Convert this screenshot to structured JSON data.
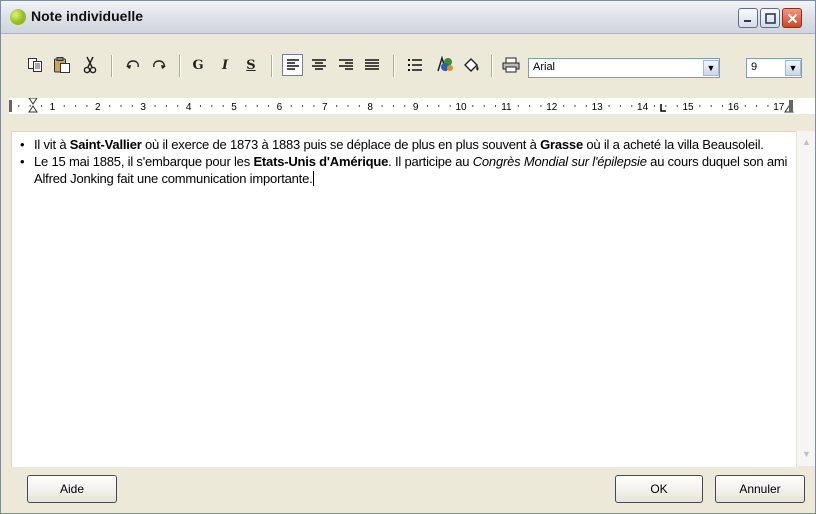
{
  "window": {
    "title": "Note individuelle",
    "controls": {
      "minimize": "–",
      "maximize": "□",
      "close": "✕"
    }
  },
  "toolbar": {
    "copy_icon": "copy-icon",
    "paste_icon": "paste-icon",
    "cut_icon": "cut-icon",
    "undo_icon": "undo-icon",
    "redo_icon": "redo-icon",
    "bold_label": "G",
    "italic_label": "I",
    "strike_label": "S",
    "font": {
      "value": "Arial"
    },
    "size": {
      "value": "9"
    },
    "dropdown_arrow": "▼"
  },
  "ruler": {
    "labels": [
      "1",
      "2",
      "3",
      "4",
      "5",
      "6",
      "7",
      "8",
      "9",
      "10",
      "11",
      "12",
      "13",
      "14",
      "15",
      "16",
      "17"
    ]
  },
  "content": {
    "bullets": [
      {
        "parts": [
          {
            "text": "Il vit  à ",
            "style": "normal"
          },
          {
            "text": "Saint-Vallier",
            "style": "bold"
          },
          {
            "text": " où il exerce  de 1873 à 1883 puis se déplace de plus en plus souvent à ",
            "style": "normal"
          },
          {
            "text": "Grasse",
            "style": "bold"
          },
          {
            "text": " où il a acheté la villa Beausoleil.",
            "style": "normal"
          }
        ]
      },
      {
        "parts": [
          {
            "text": "Le 15 mai 1885, il  s'embarque pour les  ",
            "style": "normal"
          },
          {
            "text": "Etats-Unis d'Amérique",
            "style": "bold"
          },
          {
            "text": ". Il participe au ",
            "style": "normal"
          },
          {
            "text": "Congrès Mondial sur l'épilepsie",
            "style": "italic"
          },
          {
            "text": " au cours duquel son ami Alfred Jonking fait une communication importante.",
            "style": "normal"
          }
        ]
      }
    ]
  },
  "buttons": {
    "help": "Aide",
    "ok": "OK",
    "cancel": "Annuler"
  },
  "colors": {
    "window_bg": "#ece9d8",
    "border": "#7b8ca8",
    "close_button": "#d2452a"
  }
}
